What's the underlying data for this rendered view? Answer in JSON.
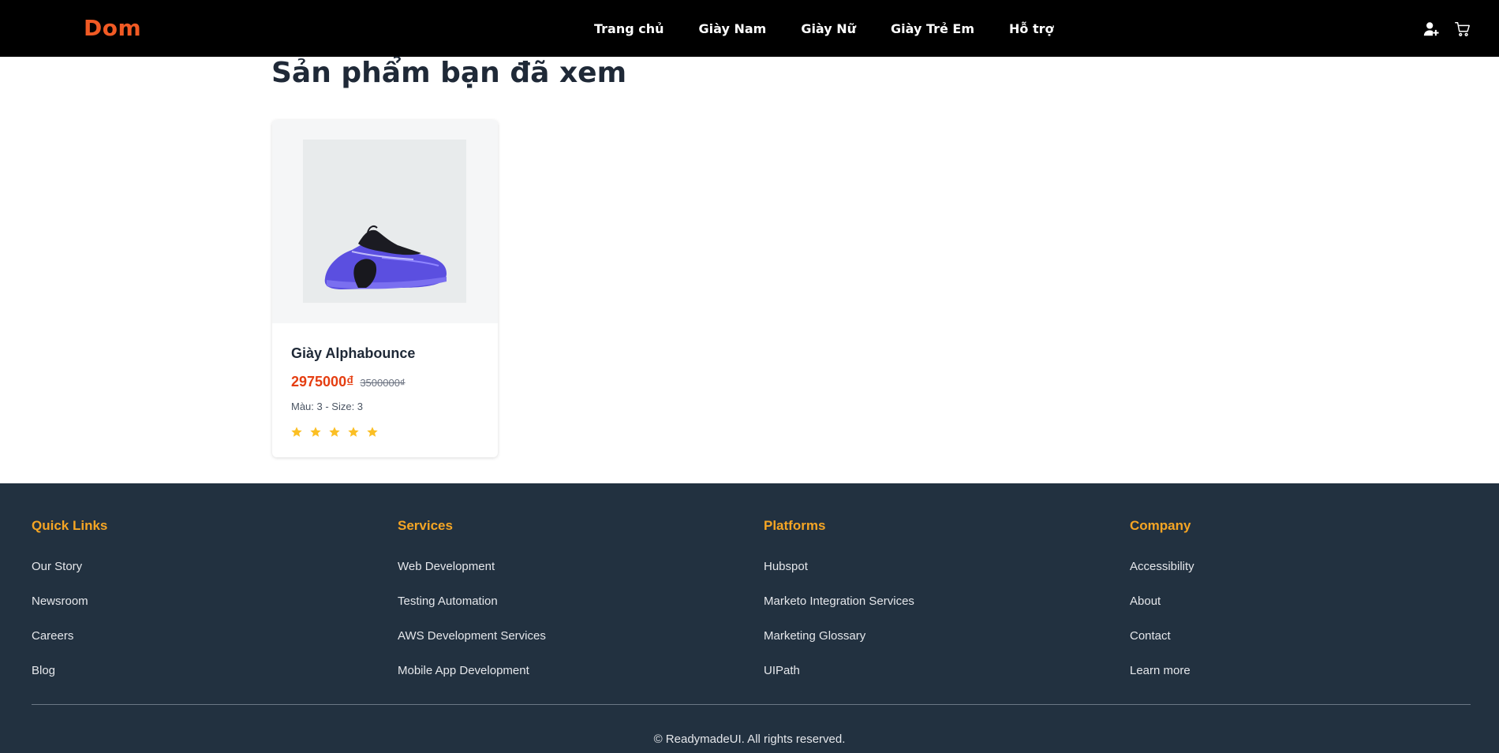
{
  "header": {
    "logo": "Dom",
    "nav": [
      "Trang chủ",
      "Giày Nam",
      "Giày Nữ",
      "Giày Trẻ Em",
      "Hỗ trợ"
    ],
    "icons": [
      "user-plus-icon",
      "cart-icon"
    ]
  },
  "main": {
    "title": "Sản phẩm bạn đã xem",
    "product": {
      "name": "Giày Alphabounce",
      "price": "2975000₫",
      "old_price": "3500000₫",
      "variant": "Màu: 3 - Size: 3",
      "rating": 5,
      "rating_max": 5
    }
  },
  "footer": {
    "columns": [
      {
        "heading": "Quick Links",
        "links": [
          "Our Story",
          "Newsroom",
          "Careers",
          "Blog"
        ]
      },
      {
        "heading": "Services",
        "links": [
          "Web Development",
          "Testing Automation",
          "AWS Development Services",
          "Mobile App Development"
        ]
      },
      {
        "heading": "Platforms",
        "links": [
          "Hubspot",
          "Marketo Integration Services",
          "Marketing Glossary",
          "UIPath"
        ]
      },
      {
        "heading": "Company",
        "links": [
          "Accessibility",
          "About",
          "Contact",
          "Learn more"
        ]
      }
    ],
    "copyright": "© ReadymadeUI. All rights reserved."
  },
  "colors": {
    "brand": "#f15a24",
    "price": "#e53e11",
    "footer_bg": "#223140",
    "footer_heading": "#f5a524",
    "star": "#fbbf24"
  }
}
